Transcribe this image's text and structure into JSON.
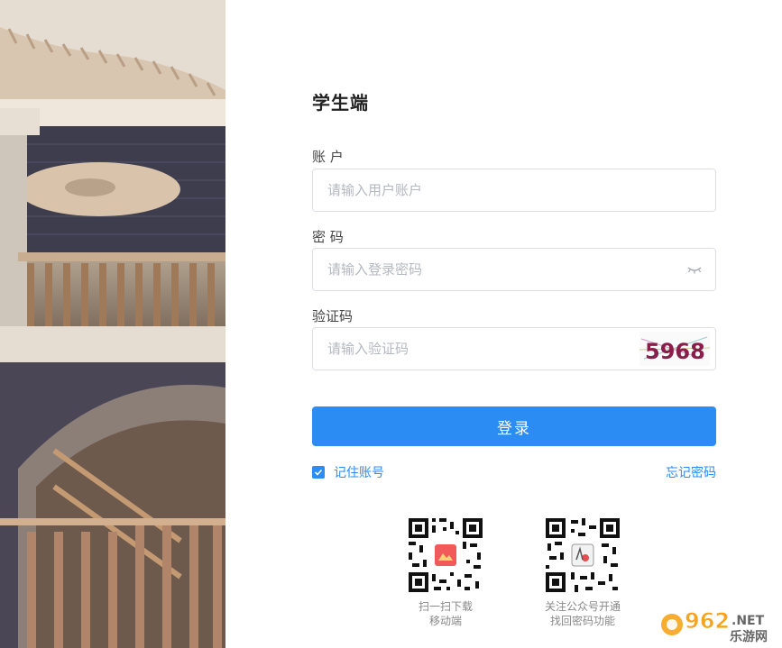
{
  "app": {
    "title": "学生端"
  },
  "form": {
    "account": {
      "label": "账  户",
      "placeholder": "请输入用户账户",
      "value": ""
    },
    "password": {
      "label": "密  码",
      "placeholder": "请输入登录密码",
      "value": ""
    },
    "captcha": {
      "label": "验证码",
      "placeholder": "请输入验证码",
      "value": "",
      "image_text": "5968"
    },
    "login_label": "登录",
    "remember_label": "记住账号",
    "remember_checked": true,
    "forgot_label": "忘记密码"
  },
  "qr": [
    {
      "caption_line1": "扫一扫下载",
      "caption_line2": "移动端"
    },
    {
      "caption_line1": "关注公众号开通",
      "caption_line2": "找回密码功能"
    }
  ],
  "watermark": {
    "text_top": "962",
    "text_suffix": ".NET",
    "text_bottom": "乐游网"
  },
  "colors": {
    "accent": "#2b8cf3",
    "border": "#dcdfe6",
    "placeholder": "#b4b8c0"
  },
  "icons": [
    "eye-closed-icon",
    "check-icon",
    "qr-code-icon"
  ]
}
